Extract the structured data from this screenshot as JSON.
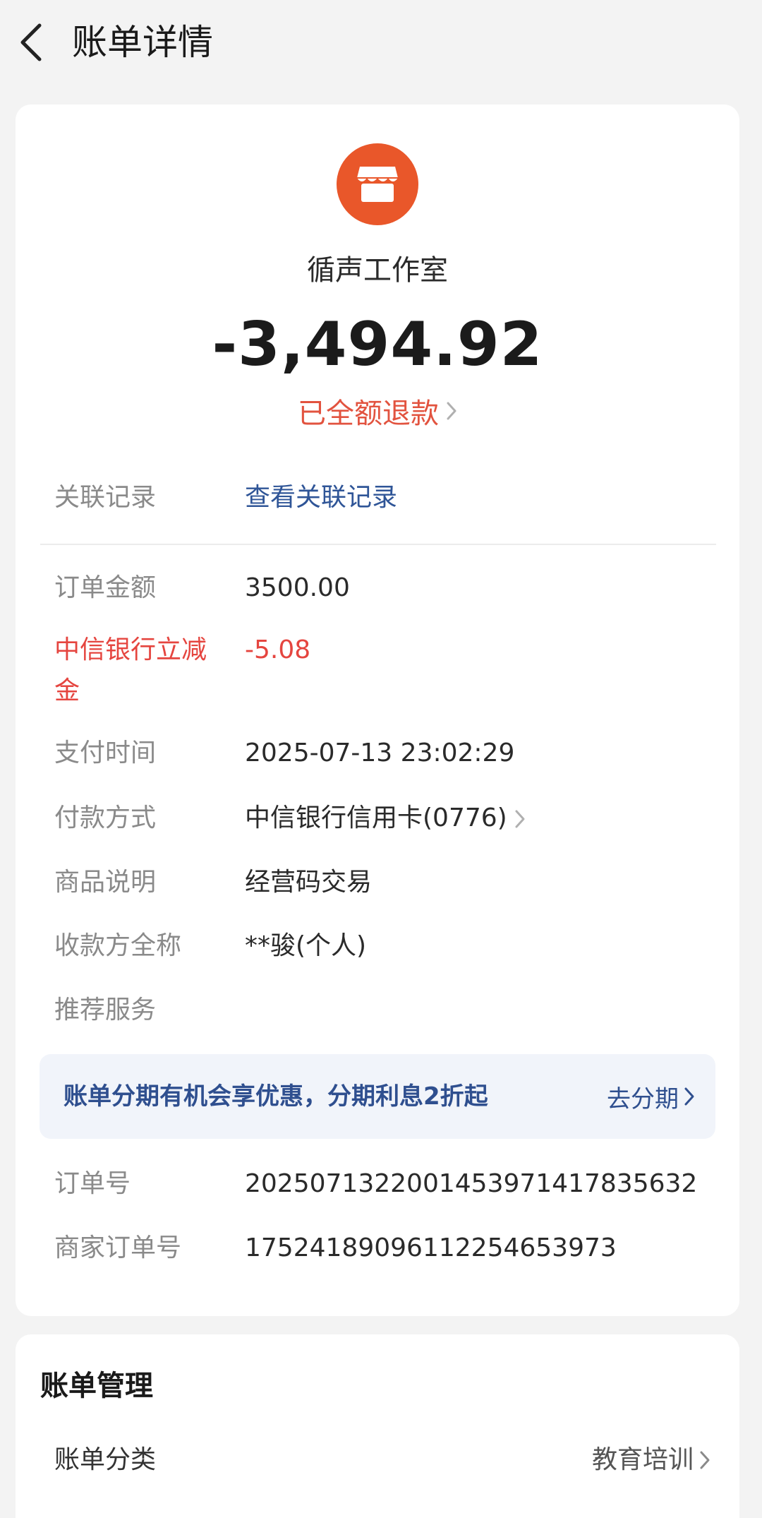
{
  "header": {
    "title": "账单详情"
  },
  "merchant": {
    "name": "循声工作室"
  },
  "transaction": {
    "amount": "-3,494.92",
    "status": "已全额退款"
  },
  "details": [
    {
      "label": "关联记录",
      "value": "查看关联记录",
      "kind": "link"
    },
    {
      "label": "订单金额",
      "value": "3500.00",
      "kind": "text"
    },
    {
      "label": "中信银行立减金",
      "value": "-5.08",
      "kind": "highlight"
    },
    {
      "label": "支付时间",
      "value": "2025-07-13 23:02:29",
      "kind": "text"
    },
    {
      "label": "付款方式",
      "value": "中信银行信用卡(0776)",
      "kind": "nav"
    },
    {
      "label": "商品说明",
      "value": "经营码交易",
      "kind": "text"
    },
    {
      "label": "收款方全称",
      "value": "**骏(个人)",
      "kind": "text"
    },
    {
      "label": "推荐服务",
      "value": "",
      "kind": "text"
    },
    {
      "label": "订单号",
      "value": "2025071322001453971417835632",
      "kind": "text"
    },
    {
      "label": "商家订单号",
      "value": "17524189096112254653973",
      "kind": "text"
    }
  ],
  "promo": {
    "text": "账单分期有机会享优惠，分期利息2折起",
    "action": "去分期"
  },
  "management": {
    "title": "账单管理",
    "category_label": "账单分类",
    "category_value": "教育培训"
  },
  "colors": {
    "accent_red": "#e5453f",
    "link_blue": "#2f5597",
    "logo_orange": "#e9572a"
  }
}
